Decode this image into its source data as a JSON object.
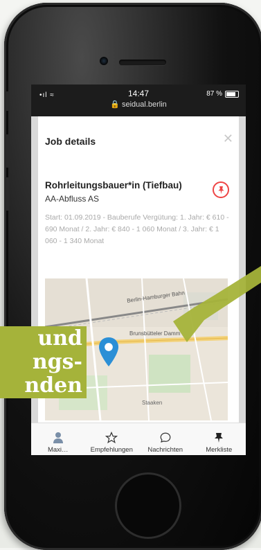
{
  "status_bar": {
    "signal": "•ıl ≈",
    "time": "14:47",
    "url": "🔒 seidual.berlin",
    "battery": "87 %"
  },
  "sheet": {
    "title": "Job details",
    "close_icon": "close-icon",
    "job_title": "Rohrleitungsbauer*in (Tiefbau)",
    "company": "AA-Abfluss AS",
    "details": "Start: 01.09.2019 - Bauberufe Vergütung: 1. Jahr: € 610 - 690 Monat / 2. Jahr: € 840 - 1 060 Monat / 3. Jahr: € 1 060 - 1 340 Monat",
    "pin_icon": "pin-icon",
    "map": {
      "street_1": "Berlin-Hamburger Bahn",
      "street_2": "Brunsbütteler Damm",
      "district": "Staaken",
      "marker_icon": "map-marker-icon"
    }
  },
  "callout": {
    "line1": "und",
    "line2": "ngs-",
    "line3": "nden"
  },
  "tabbar": {
    "items": [
      {
        "label": "Maxi…",
        "icon": "avatar-icon"
      },
      {
        "label": "Empfehlungen",
        "icon": "star-icon"
      },
      {
        "label": "Nachrichten",
        "icon": "chat-icon"
      },
      {
        "label": "Merkliste",
        "icon": "pin-icon"
      }
    ]
  },
  "colors": {
    "accent_green": "#a5b33a",
    "pin_red": "#e44444",
    "marker_blue": "#2b8fd6"
  }
}
